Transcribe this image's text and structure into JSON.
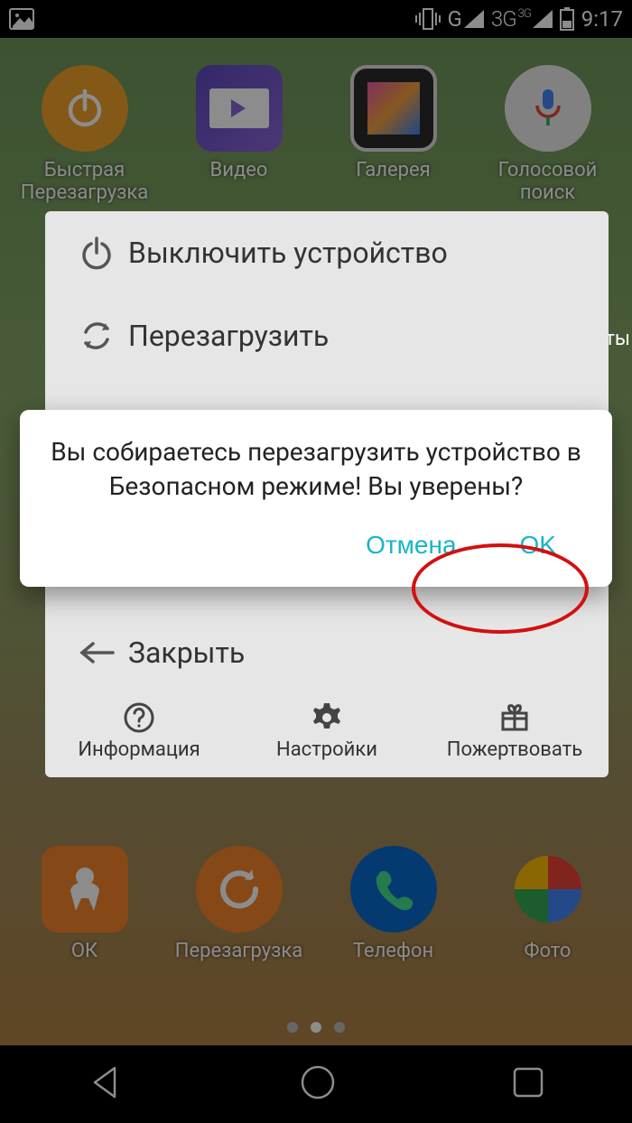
{
  "statusbar": {
    "network1": "G",
    "network2": "3G",
    "network2_sup": "3G",
    "time": "9:17"
  },
  "home": {
    "row1": [
      {
        "label": "Быстрая\nПерезагрузка"
      },
      {
        "label": "Видео"
      },
      {
        "label": "Галерея"
      },
      {
        "label": "Голосовой\nпоиск"
      }
    ],
    "row2": [
      {
        "label": "ОК"
      },
      {
        "label": "Перезагрузка"
      },
      {
        "label": "Телефон"
      },
      {
        "label": "Фото"
      }
    ]
  },
  "powermenu": {
    "poweroff": "Выключить устройство",
    "reboot": "Перезагрузить",
    "close": "Закрыть",
    "info": "Информация",
    "settings": "Настройки",
    "donate": "Пожертвовать"
  },
  "dialog": {
    "message": "Вы собираетесь перезагрузить устройство в Безопасном режиме! Вы уверены?",
    "cancel": "Отмена",
    "ok": "OK"
  },
  "extra_text": "ты"
}
